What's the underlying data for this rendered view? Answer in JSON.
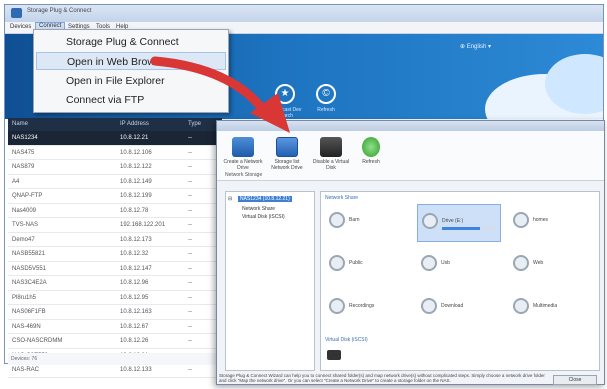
{
  "app": {
    "title": "Storage Plug & Connect"
  },
  "menubar": {
    "items": [
      "Devices",
      "Connect",
      "Settings",
      "Tools",
      "Help"
    ]
  },
  "banner": {
    "language": "English",
    "buttons": [
      "Broadcast Dev Search",
      "Refresh"
    ]
  },
  "dropdown": {
    "items": [
      "Storage Plug & Connect",
      "Open in Web Browser",
      "Open in File Explorer",
      "Connect via FTP"
    ]
  },
  "list": {
    "headers": [
      "Name",
      "IP Address",
      "Type"
    ],
    "rows": [
      {
        "name": "NAS1234",
        "ip": "10.8.12.21",
        "type": "--"
      },
      {
        "name": "NAS475",
        "ip": "10.8.12.106",
        "type": "--"
      },
      {
        "name": "NAS879",
        "ip": "10.8.12.122",
        "type": "--"
      },
      {
        "name": "A4",
        "ip": "10.8.12.149",
        "type": "--"
      },
      {
        "name": "QNAP-FTP",
        "ip": "10.8.12.199",
        "type": "--"
      },
      {
        "name": "Nas4009",
        "ip": "10.8.12.78",
        "type": "--"
      },
      {
        "name": "TVS-NAS",
        "ip": "192.168.122.201",
        "type": "--"
      },
      {
        "name": "Demo47",
        "ip": "10.8.12.173",
        "type": "--"
      },
      {
        "name": "NASB55821",
        "ip": "10.8.12.32",
        "type": "--"
      },
      {
        "name": "NASD5V551",
        "ip": "10.8.12.147",
        "type": "--"
      },
      {
        "name": "NAS3C4E2A",
        "ip": "10.8.12.96",
        "type": "--"
      },
      {
        "name": "Pl8ru1h5",
        "ip": "10.8.12.95",
        "type": "--"
      },
      {
        "name": "NAS06F1FB",
        "ip": "10.8.12.163",
        "type": "--"
      },
      {
        "name": "NAS-469N",
        "ip": "10.8.12.67",
        "type": "--"
      },
      {
        "name": "CSO-NASCRDMM",
        "ip": "10.8.12.26",
        "type": "--"
      },
      {
        "name": "NAS-C9E559",
        "ip": "10.8.12.81",
        "type": "--"
      },
      {
        "name": "NAS-RAC",
        "ip": "10.8.12.133",
        "type": "--"
      }
    ],
    "status": "Devices: 76"
  },
  "dialog": {
    "toolbar": {
      "buttons": [
        "Create a Network Drive",
        "Storage list Network Drive",
        "Disable a Virtual Disk",
        "Refresh"
      ],
      "group_label": "Network Storage"
    },
    "tree": {
      "root": "NAS1234 (10.8.12.21)",
      "children": [
        "Network Share",
        "Virtual Disk (iSCSI)"
      ]
    },
    "content": {
      "group_label": "Network Share",
      "folders": [
        {
          "name": "Barn",
          "usage": 0
        },
        {
          "name": "Drive (E:)",
          "usage": 0.7
        },
        {
          "name": "homes"
        },
        {
          "name": "Public"
        },
        {
          "name": "Usb"
        },
        {
          "name": "Web"
        },
        {
          "name": "Recordings"
        },
        {
          "name": "Download"
        },
        {
          "name": "Multimedia"
        }
      ],
      "other_label": "Virtual Disk (iSCSI)"
    },
    "footer": "Storage Plug & Connect Wizard can help you to connect shared folder(s) and map network drive(s) without complicated steps. Simply choose a network drive folder and click \"Map the network drive\". Or you can select \"Create a Network Drive\" to create a storage folder on the NAS.",
    "close_label": "Close"
  },
  "colors": {
    "banner": "#1d73bf",
    "selected_row": "#1a2536",
    "arrow": "#d93636"
  }
}
